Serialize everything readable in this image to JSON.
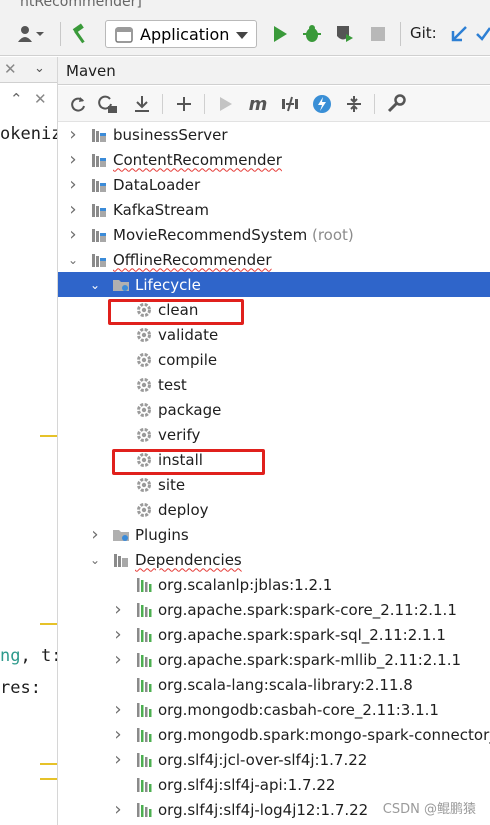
{
  "window": {
    "title_fragment": "ntRecommender]"
  },
  "toolbar": {
    "run_config": "Application",
    "git_label": "Git:"
  },
  "editor": {
    "code_line_1": "okeniz",
    "code_line_2_teal": "ng",
    "code_line_2_rest": ", t:",
    "code_line_3": "res: "
  },
  "maven": {
    "title": "Maven",
    "tools": [
      "refresh-icon",
      "reimport-icon",
      "download-icon",
      "add-icon",
      "run-icon",
      "maven-goal-icon",
      "toggle-offline-icon",
      "skip-tests-icon",
      "show-dependencies-icon",
      "settings-icon"
    ],
    "projects": [
      {
        "label": "businessServer",
        "squiggle": false
      },
      {
        "label": "ContentRecommender",
        "squiggle": true
      },
      {
        "label": "DataLoader",
        "squiggle": false
      },
      {
        "label": "KafkaStream",
        "squiggle": false
      },
      {
        "label": "MovieRecommendSystem",
        "suffix": "(root)",
        "squiggle": false
      },
      {
        "label": "OfflineRecommender",
        "squiggle": true
      }
    ],
    "lifecycle": {
      "label": "Lifecycle",
      "goals": [
        "clean",
        "validate",
        "compile",
        "test",
        "package",
        "verify",
        "install",
        "site",
        "deploy"
      ]
    },
    "plugins_label": "Plugins",
    "dependencies_label": "Dependencies",
    "dependencies": [
      {
        "label": "org.scalanlp:jblas:1.2.1",
        "expandable": false
      },
      {
        "label": "org.apache.spark:spark-core_2.11:2.1.1",
        "expandable": true
      },
      {
        "label": "org.apache.spark:spark-sql_2.11:2.1.1",
        "expandable": true
      },
      {
        "label": "org.apache.spark:spark-mllib_2.11:2.1.1",
        "expandable": true
      },
      {
        "label": "org.scala-lang:scala-library:2.11.8",
        "expandable": false
      },
      {
        "label": "org.mongodb:casbah-core_2.11:3.1.1",
        "expandable": true
      },
      {
        "label": "org.mongodb.spark:mongo-spark-connector_",
        "expandable": true
      },
      {
        "label": "org.slf4j:jcl-over-slf4j:1.7.22",
        "expandable": true
      },
      {
        "label": "org.slf4j:slf4j-api:1.7.22",
        "expandable": false
      },
      {
        "label": "org.slf4j:slf4j-log4j12:1.7.22",
        "expandable": true
      }
    ],
    "highlighted_goals": [
      "clean",
      "install"
    ]
  },
  "watermark": "CSDN @鲲鹏猿",
  "colors": {
    "selection": "#2f65ca",
    "highlight_box": "#e0201c",
    "run_green": "#3a9a3a",
    "git_blue": "#2d7fd4"
  }
}
